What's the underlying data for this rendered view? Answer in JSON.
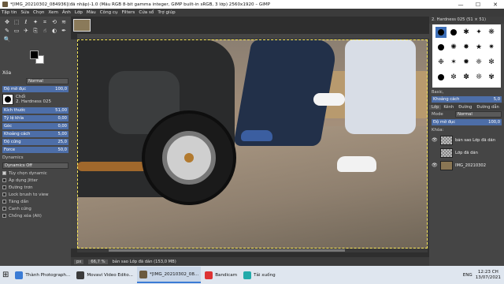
{
  "window": {
    "title": "*[IMG_20210302_084936](đã nhập)-1.0 (Mẫu RGB 8-bit gamma integer, GIMP built-in sRGB, 3 lớp) 2560x1920 – GIMP",
    "controls": [
      "—",
      "☐",
      "✕"
    ]
  },
  "menu": [
    "Tập tin",
    "Sửa",
    "Chọn",
    "Xem",
    "Ảnh",
    "Lớp",
    "Màu",
    "Công cụ",
    "Filters",
    "Cửa sổ",
    "Trợ giúp"
  ],
  "toolbox": {
    "tools": [
      {
        "icon": "move-icon",
        "glyph": "✥"
      },
      {
        "icon": "rect-select-icon",
        "glyph": "⬚"
      },
      {
        "icon": "lasso-icon",
        "glyph": "ℓ"
      },
      {
        "icon": "fuzzy-select-icon",
        "glyph": "✦"
      },
      {
        "icon": "crop-icon",
        "glyph": "⌗"
      },
      {
        "icon": "rotate-icon",
        "glyph": "⟲"
      },
      {
        "icon": "warp-icon",
        "glyph": "≋"
      },
      {
        "icon": "fill-icon",
        "glyph": "◍"
      },
      {
        "icon": "paintbrush-icon",
        "glyph": "✎"
      },
      {
        "icon": "eraser-icon",
        "glyph": "▭"
      },
      {
        "icon": "airbrush-icon",
        "glyph": "✈"
      },
      {
        "icon": "clone-icon",
        "glyph": "⎘"
      },
      {
        "icon": "smudge-icon",
        "glyph": "☝"
      },
      {
        "icon": "dodge-icon",
        "glyph": "◐"
      },
      {
        "icon": "paths-icon",
        "glyph": "✒"
      },
      {
        "icon": "text-icon",
        "glyph": "A"
      },
      {
        "icon": "zoom-icon",
        "glyph": "🔍"
      }
    ],
    "section_title": "Xóa",
    "mode_value": "Normal",
    "opacity": {
      "label": "Độ mờ đục",
      "value": "100,0"
    },
    "brush": {
      "label": "Chổi",
      "name": "2. Hardness 025"
    },
    "rows": [
      {
        "label": "Kích thước",
        "value": "51,00"
      },
      {
        "label": "Tỷ lệ khía",
        "value": "0,00"
      },
      {
        "label": "Góc",
        "value": "0,00"
      },
      {
        "label": "Khoảng cách",
        "value": "5,00"
      },
      {
        "label": "Độ cứng",
        "value": "25,0"
      },
      {
        "label": "Force",
        "value": "50,0"
      }
    ],
    "dynamics": {
      "label": "Dynamics",
      "value": "Dynamics Off"
    },
    "checks": [
      {
        "label": "Tùy chọn dynamic",
        "checked": true
      },
      {
        "label": "Áp dụng Jitter",
        "checked": false
      },
      {
        "label": "Đường trơn",
        "checked": false
      },
      {
        "label": "Lock brush to view",
        "checked": false
      },
      {
        "label": "Tăng dần",
        "checked": false
      },
      {
        "label": "Canh cứng",
        "checked": false
      },
      {
        "label": "Chống xóa (Alt)",
        "checked": false
      }
    ]
  },
  "status": {
    "unit": "px",
    "zoom": "66,7 %",
    "info": "bản sao Lớp đã dán (153,0 MB)"
  },
  "right_dock": {
    "brush_header": "2. Hardness 025 (51 × 51)",
    "preset": "Basic,",
    "spacing": {
      "label": "Khoảng cách",
      "value": "5,0"
    },
    "tabs": [
      "Lớp",
      "Kênh",
      "Đường",
      "Đường dẫn"
    ],
    "mode": {
      "label": "Mode",
      "value": "Normal"
    },
    "opacity": {
      "label": "Độ mờ đục",
      "value": "100,0"
    },
    "lock_label": "Khóa:",
    "fill": {
      "label": "Fill",
      "value": "100,0"
    },
    "layers": [
      {
        "name": "bản sao Lớp đã dán",
        "thumb": "checker",
        "visible": true,
        "selected": false
      },
      {
        "name": "Lớp đã dán",
        "thumb": "checker",
        "visible": false,
        "selected": false
      },
      {
        "name": "IMG_20210302",
        "thumb": "img",
        "visible": true,
        "selected": false
      }
    ]
  },
  "taskbar": {
    "items": [
      {
        "label": "Thành Photograph...",
        "color": "#3a7bd5",
        "active": false
      },
      {
        "label": "Movavi Video Edito...",
        "color": "#3b3b3b",
        "active": false
      },
      {
        "label": "*[IMG_20210302_08...",
        "color": "#6b5a3e",
        "active": true
      },
      {
        "label": "Bandicam",
        "color": "#d33",
        "active": false
      },
      {
        "label": "Tải xuống",
        "color": "#2aa",
        "active": false
      }
    ],
    "lang": "ENG",
    "time": "12:23 CH",
    "date": "13/07/2021"
  }
}
